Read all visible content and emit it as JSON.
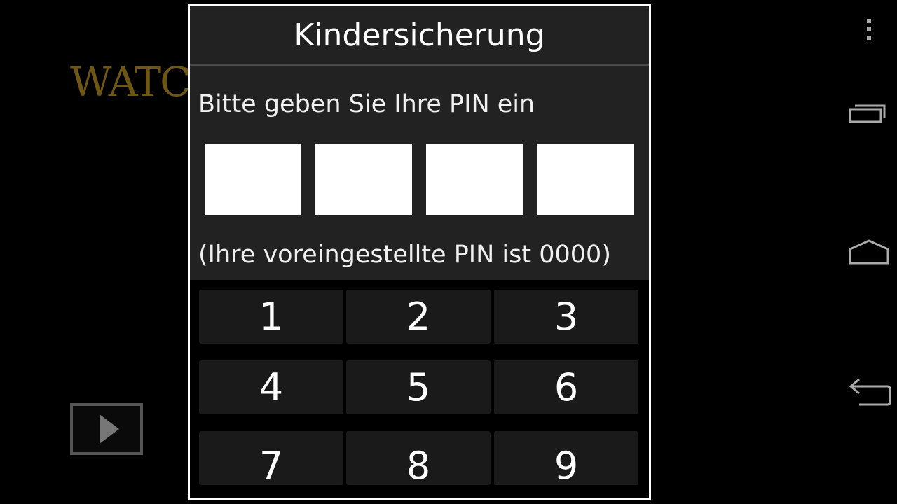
{
  "background": {
    "logo_text": "WATC",
    "play_icon": "play-icon"
  },
  "dialog": {
    "title": "Kindersicherung",
    "prompt": "Bitte geben Sie Ihre PIN ein",
    "pin_values": [
      "",
      "",
      "",
      ""
    ],
    "hint": "(Ihre voreingestellte PIN ist 0000)",
    "keys": [
      "1",
      "2",
      "3",
      "4",
      "5",
      "6",
      "7",
      "8",
      "9"
    ]
  },
  "navbar": {
    "icons": [
      "overflow-menu-icon",
      "recent-apps-icon",
      "home-icon",
      "back-icon"
    ]
  },
  "colors": {
    "dialog_bg": "#222222",
    "key_bg": "#1a1a1a",
    "logo": "#6e5614"
  }
}
